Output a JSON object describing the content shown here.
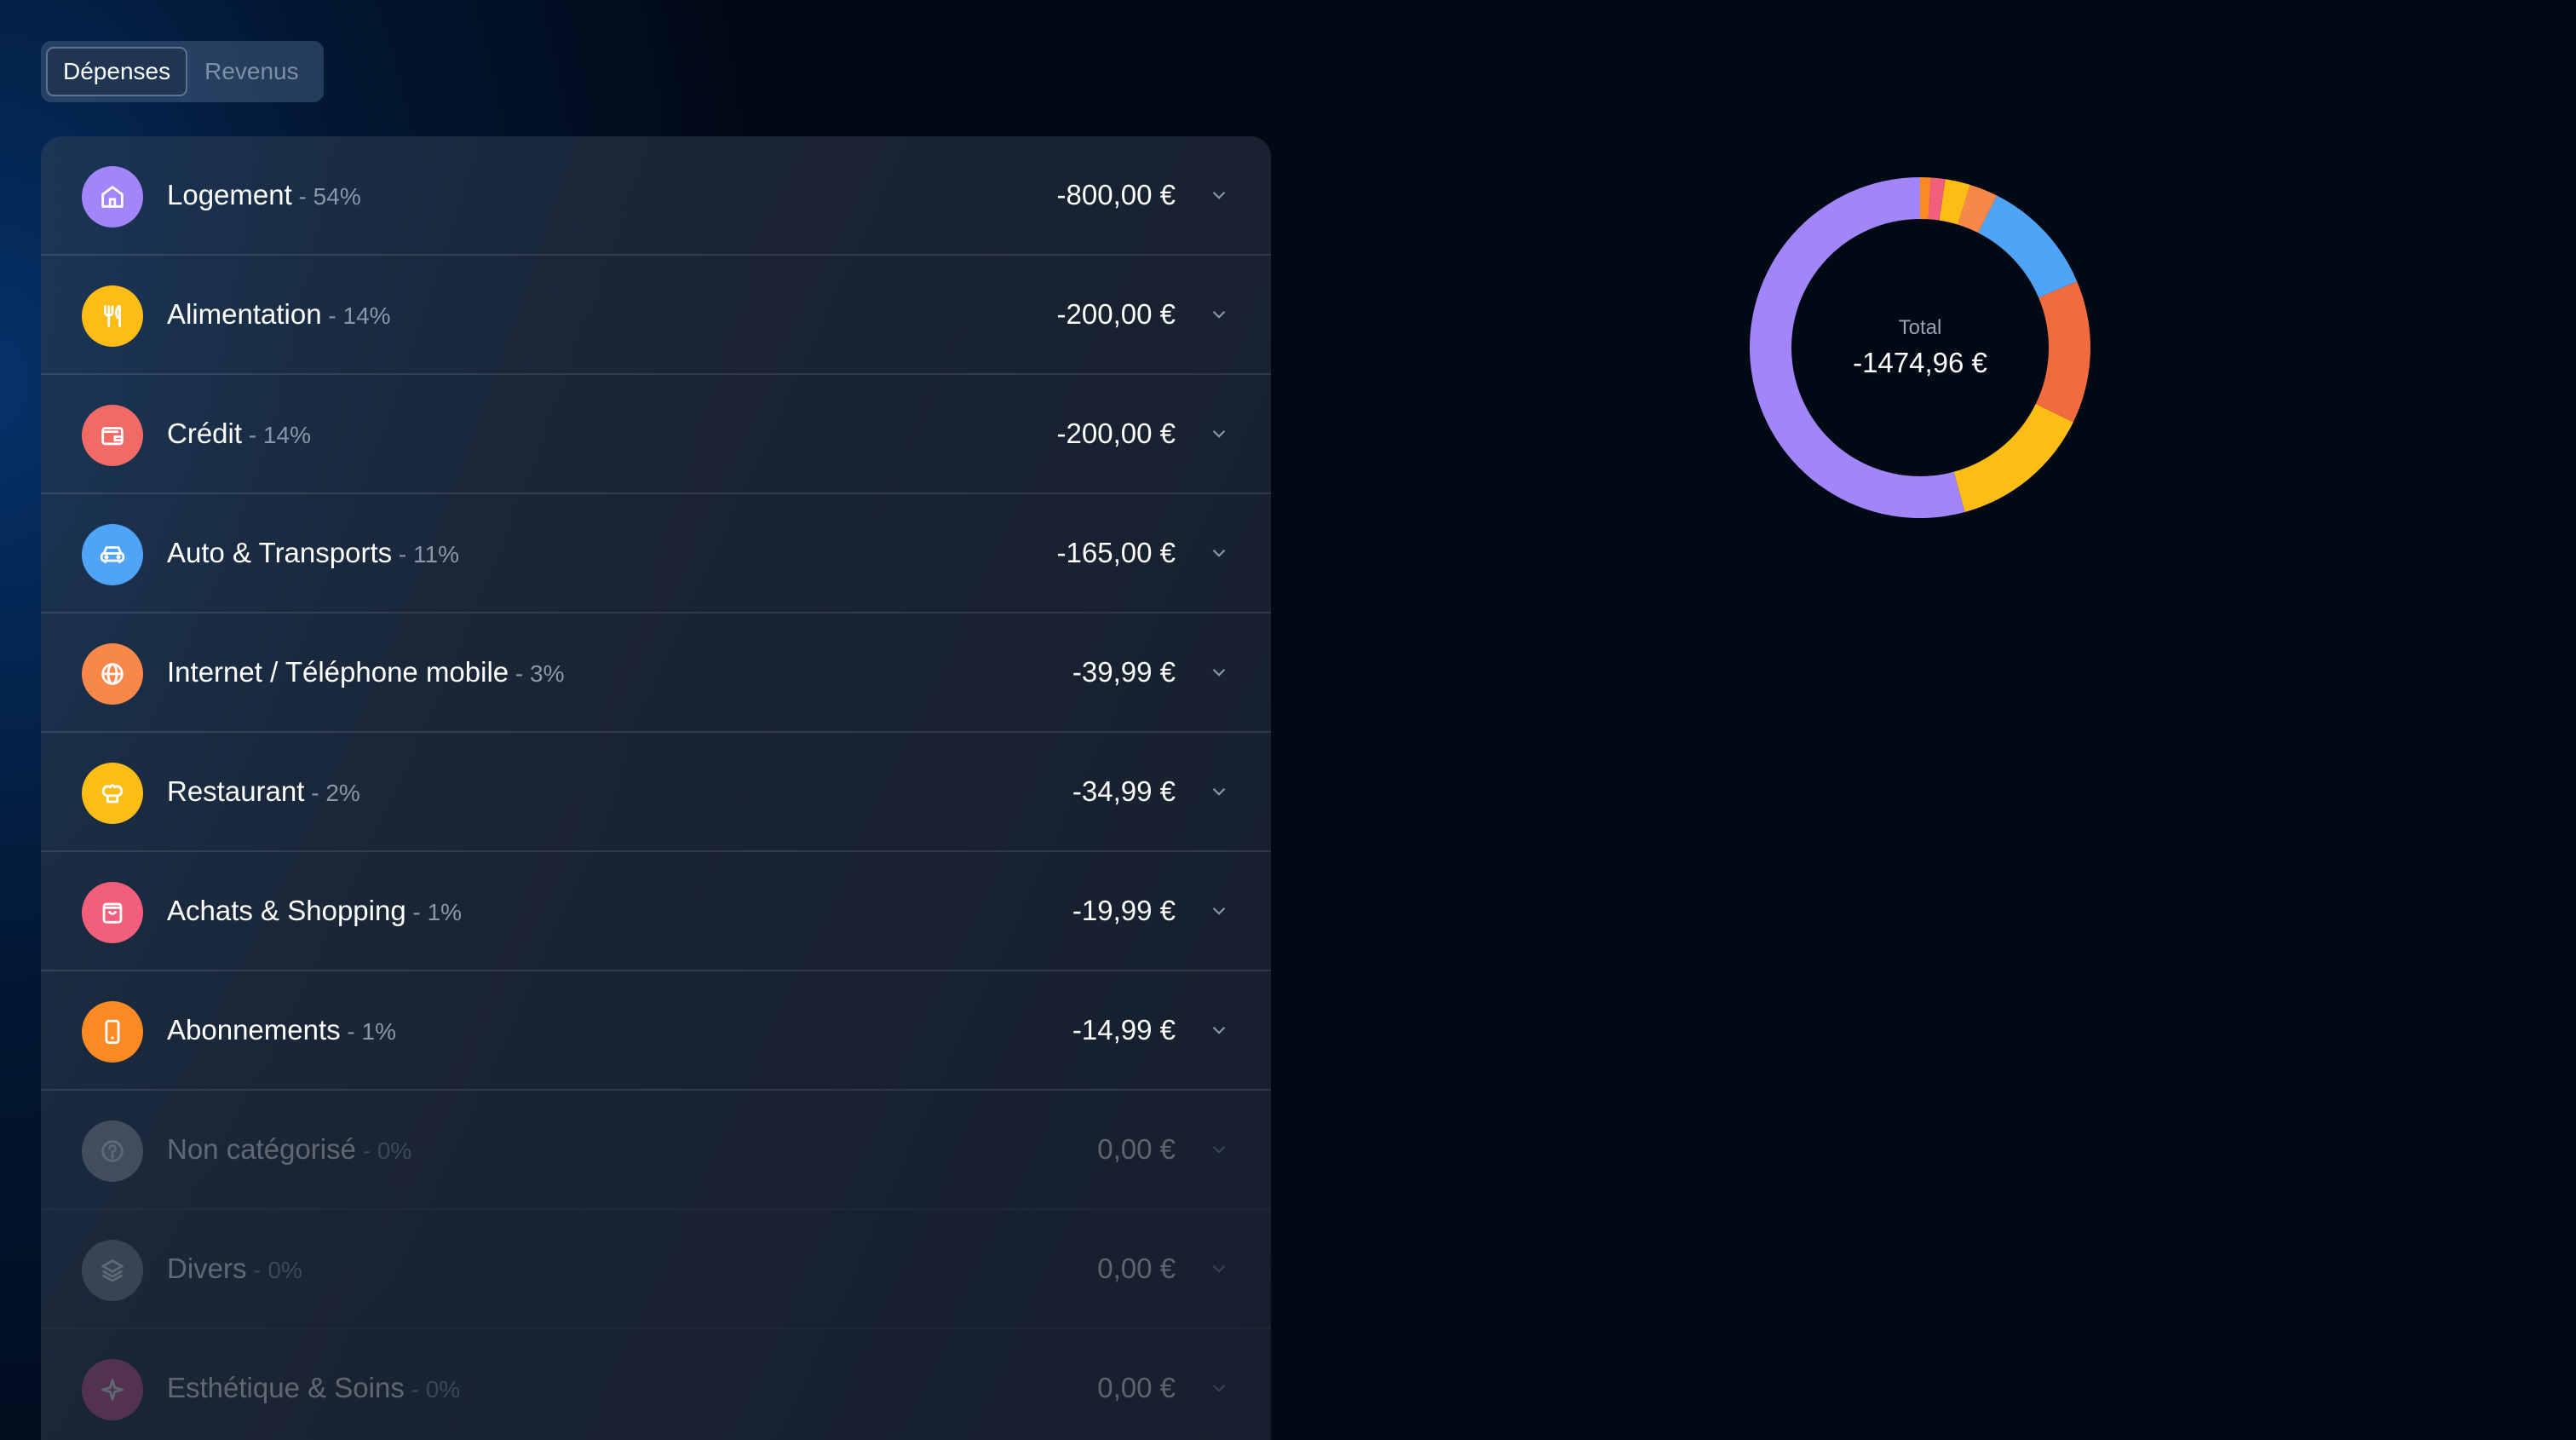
{
  "tabs": [
    {
      "label": "Dépenses",
      "active": true
    },
    {
      "label": "Revenus",
      "active": false
    }
  ],
  "separator": " - ",
  "categories": [
    {
      "name": "Logement",
      "pct": "54%",
      "amount": "-800,00 €",
      "icon": "home-icon",
      "color": "#a385fa"
    },
    {
      "name": "Alimentation",
      "pct": "14%",
      "amount": "-200,00 €",
      "icon": "fork-knife-icon",
      "color": "#fdbc16"
    },
    {
      "name": "Crédit",
      "pct": "14%",
      "amount": "-200,00 €",
      "icon": "wallet-icon",
      "color": "#f06b66"
    },
    {
      "name": "Auto & Transports",
      "pct": "11%",
      "amount": "-165,00 €",
      "icon": "car-icon",
      "color": "#4fa4f8"
    },
    {
      "name": "Internet / Téléphone mobile",
      "pct": "3%",
      "amount": "-39,99 €",
      "icon": "globe-icon",
      "color": "#f8874a"
    },
    {
      "name": "Restaurant",
      "pct": "2%",
      "amount": "-34,99 €",
      "icon": "chef-hat-icon",
      "color": "#fdbc16"
    },
    {
      "name": "Achats & Shopping",
      "pct": "1%",
      "amount": "-19,99 €",
      "icon": "shopping-bag-icon",
      "color": "#f25f7d"
    },
    {
      "name": "Abonnements",
      "pct": "1%",
      "amount": "-14,99 €",
      "icon": "smartphone-icon",
      "color": "#fb8a25"
    },
    {
      "name": "Non catégorisé",
      "pct": "0%",
      "amount": "0,00 €",
      "icon": "question-icon",
      "color": "#9aa3ae"
    },
    {
      "name": "Divers",
      "pct": "0%",
      "amount": "0,00 €",
      "icon": "layers-icon",
      "color": "#7d8794"
    },
    {
      "name": "Esthétique & Soins",
      "pct": "0%",
      "amount": "0,00 €",
      "icon": "sparkle-icon",
      "color": "#d2508a"
    }
  ],
  "donut": {
    "label": "Total",
    "total": "-1474,96 €"
  },
  "chart_data": {
    "type": "pie",
    "title": "",
    "center_label": "Total",
    "center_value": "-1474,96 €",
    "series": [
      {
        "name": "Logement",
        "value": 800.0,
        "color": "#a385fa"
      },
      {
        "name": "Alimentation",
        "value": 200.0,
        "color": "#fdbc16"
      },
      {
        "name": "Crédit",
        "value": 200.0,
        "color": "#f06b3e"
      },
      {
        "name": "Auto & Transports",
        "value": 165.0,
        "color": "#4fa4f8"
      },
      {
        "name": "Internet / Téléphone mobile",
        "value": 39.99,
        "color": "#f8874a"
      },
      {
        "name": "Restaurant",
        "value": 34.99,
        "color": "#fdbc16"
      },
      {
        "name": "Achats & Shopping",
        "value": 19.99,
        "color": "#f25f7d"
      },
      {
        "name": "Abonnements",
        "value": 14.99,
        "color": "#fb8a25"
      }
    ]
  }
}
